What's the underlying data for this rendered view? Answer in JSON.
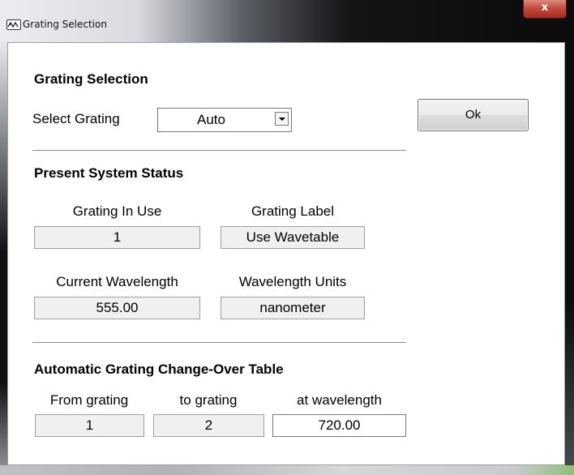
{
  "window": {
    "title": "Grating Selection",
    "close_glyph": "x"
  },
  "grating_selection": {
    "heading": "Grating Selection",
    "select_label": "Select Grating",
    "selected_value": "Auto",
    "ok_label": "Ok"
  },
  "status": {
    "heading": "Present System Status",
    "grating_in_use_label": "Grating In Use",
    "grating_in_use_value": "1",
    "grating_label_label": "Grating Label",
    "grating_label_value": "Use Wavetable",
    "current_wavelength_label": "Current Wavelength",
    "current_wavelength_value": "555.00",
    "wavelength_units_label": "Wavelength Units",
    "wavelength_units_value": "nanometer"
  },
  "changeover": {
    "heading": "Automatic Grating Change-Over Table",
    "from_label": "From grating",
    "from_value": "1",
    "to_label": "to grating",
    "to_value": "2",
    "at_label": "at wavelength",
    "at_value": "720.00"
  },
  "colors": {
    "title_bar_dark": "#0b0b0c",
    "close_button": "#c0473a",
    "field_bg": "#f0f0f0"
  }
}
